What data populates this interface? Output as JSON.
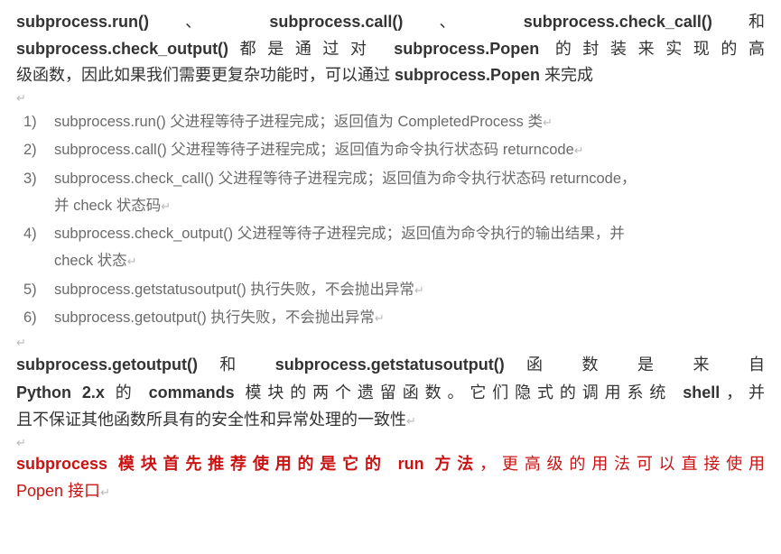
{
  "intro": {
    "seg1": "subprocess.run()",
    "sep1": " 、 ",
    "seg2": "subprocess.call()",
    "sep2": " 、 ",
    "seg3": "subprocess.check_call()",
    "tail1": " 和",
    "seg4": "subprocess.check_output()",
    "txt5": "都是通过对 ",
    "seg6": "subprocess.Popen",
    "txt7": " 的封装来实现的高",
    "line2a": "级函数，因此如果我们需要更复杂功能时，可以通过 ",
    "seg8": "subprocess.Popen",
    "line2b": " 来完成"
  },
  "pm": "↵",
  "list": [
    {
      "n": "1)",
      "text": "subprocess.run() 父进程等待子进程完成；返回值为 CompletedProcess 类"
    },
    {
      "n": "2)",
      "text": "subprocess.call() 父进程等待子进程完成；返回值为命令执行状态码 returncode"
    },
    {
      "n": "3)",
      "text": "subprocess.check_call() 父进程等待子进程完成；返回值为命令执行状态码 returncode，",
      "cont": "并 check 状态码"
    },
    {
      "n": "4)",
      "text": "subprocess.check_output() 父进程等待子进程完成；返回值为命令执行的输出结果，并",
      "cont": "check 状态"
    },
    {
      "n": "5)",
      "text": "subprocess.getstatusoutput() 执行失败，不会抛出异常"
    },
    {
      "n": "6)",
      "text": "subprocess.getoutput() 执行失败，不会抛出异常"
    }
  ],
  "para2": {
    "a1": "subprocess.getoutput()",
    "a2": " 和   ",
    "a3": "subprocess.getstatusoutput()",
    "a4": " 函 数 是 来 自",
    "b1": "Python 2.x",
    "b2": " 的 ",
    "b3": "commands",
    "b4": " 模块的两个遗留函数。它们隐式的调用系统 ",
    "b5": "shell",
    "b6": "，并",
    "c1": "且不保证其他函数所具有的安全性和异常处理的一致性"
  },
  "para3": {
    "a1": "subprocess 模块首先推荐使用的是它的 run 方法",
    "a2": "，更高级的用法可以直接使用",
    "b1": "Popen 接口"
  },
  "marks": {
    "ret": "↵"
  }
}
